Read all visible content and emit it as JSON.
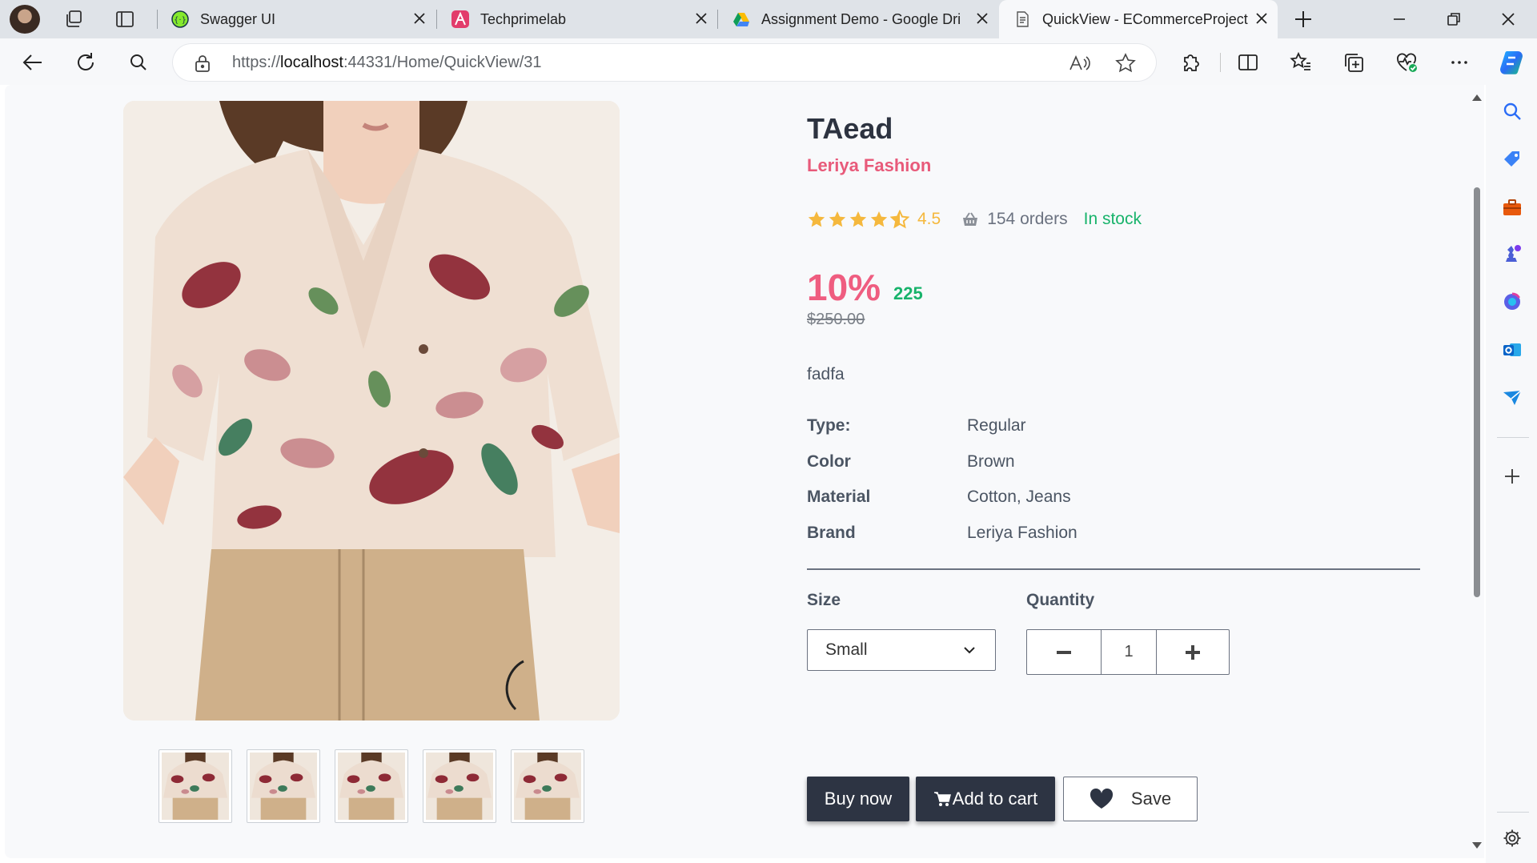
{
  "browser": {
    "tabs": [
      {
        "title": "Swagger UI",
        "active": false
      },
      {
        "title": "Techprimelab",
        "active": false
      },
      {
        "title": "Assignment Demo - Google Dri",
        "active": false
      },
      {
        "title": "QuickView - ECommerceProject",
        "active": true
      }
    ],
    "url_scheme_host": "https://",
    "url_host": "localhost",
    "url_rest": ":44331/Home/QuickView/31"
  },
  "product": {
    "name": "TAead",
    "brand_line": "Leriya Fashion",
    "rating": "4.5",
    "rating_value": 4.5,
    "orders": "154 orders",
    "stock": "In stock",
    "discount": "10%",
    "price": "225",
    "old_price": "$250.00",
    "description": "fadfa",
    "specs": [
      {
        "key": "Type:",
        "value": "Regular"
      },
      {
        "key": "Color",
        "value": "Brown"
      },
      {
        "key": "Material",
        "value": "Cotton, Jeans"
      },
      {
        "key": "Brand",
        "value": "Leriya Fashion"
      }
    ],
    "size_label": "Size",
    "size_selected": "Small",
    "quantity_label": "Quantity",
    "quantity": "1",
    "thumbnail_count": 5
  },
  "actions": {
    "buy_now": "Buy now",
    "add_to_cart": "Add to cart",
    "save": "Save"
  },
  "colors": {
    "brand_pink": "#e85a7a",
    "discount_pink": "#ef5d80",
    "success_green": "#18b36b",
    "star_gold": "#f5b83d",
    "dark_button": "#2d3443"
  },
  "icons": [
    "profile-avatar",
    "workspaces-icon",
    "tab-actions-icon",
    "back-icon",
    "refresh-icon",
    "search-icon",
    "lock-icon",
    "read-aloud-icon",
    "favorite-star-icon",
    "extensions-icon",
    "split-screen-icon",
    "favorites-icon",
    "collections-icon",
    "health-icon",
    "more-icon",
    "copilot-icon",
    "star-icon",
    "basket-icon",
    "chevron-down-icon",
    "minus-icon",
    "plus-icon",
    "cart-icon",
    "heart-icon",
    "settings-icon"
  ]
}
